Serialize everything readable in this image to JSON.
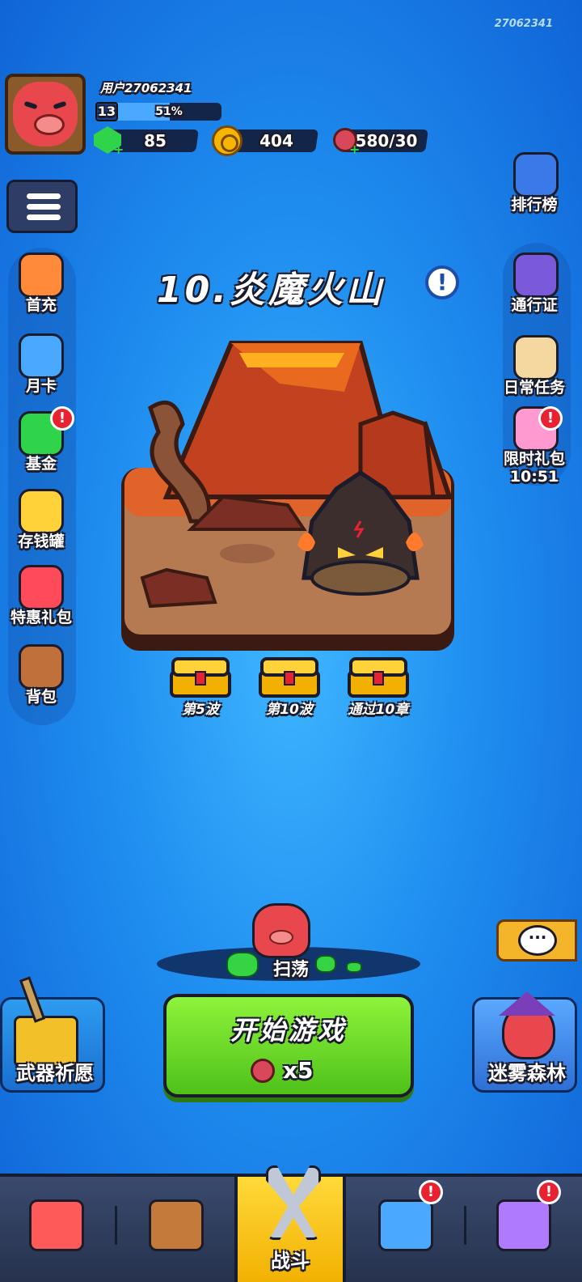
{
  "uid_watermark": "27062341",
  "player": {
    "username": "用户27062341",
    "level": "13",
    "xp_percent_label": "51%",
    "xp_fraction": 0.51,
    "gems": "85",
    "coins": "404",
    "stamina": "580/30"
  },
  "stage": {
    "title": "10.炎魔火山",
    "rewards": [
      {
        "label": "第5波"
      },
      {
        "label": "第10波"
      },
      {
        "label": "通过10章"
      }
    ]
  },
  "left_sidebar": [
    {
      "label": "首充",
      "icon": "first-recharge-icon",
      "badge": false
    },
    {
      "label": "月卡",
      "icon": "monthly-card-icon",
      "badge": false
    },
    {
      "label": "基金",
      "icon": "fund-icon",
      "badge": true
    },
    {
      "label": "存钱罐",
      "icon": "piggy-bank-icon",
      "badge": false
    },
    {
      "label": "特惠礼包",
      "icon": "gift-box-icon",
      "badge": false
    },
    {
      "label": "背包",
      "icon": "backpack-icon",
      "badge": false
    }
  ],
  "right_sidebar": [
    {
      "label": "排行榜",
      "icon": "leaderboard-icon",
      "badge": false
    },
    {
      "label": "通行证",
      "icon": "pass-icon",
      "badge": false
    },
    {
      "label": "日常任务",
      "icon": "daily-task-icon",
      "badge": false
    },
    {
      "label": "限时礼包",
      "icon": "limited-gift-icon",
      "badge": true,
      "timer": "10:51"
    }
  ],
  "badge_mark": "!",
  "sweep_label": "扫荡",
  "chat_icon_text": "···",
  "start_button": {
    "label": "开始游戏",
    "cost": "x5"
  },
  "features": {
    "left": "武器祈愿",
    "right": "迷雾森林"
  },
  "bottom_nav": [
    {
      "icon": "shop-icon",
      "label": "",
      "active": false,
      "badge": false
    },
    {
      "icon": "equipment-icon",
      "label": "",
      "active": false,
      "badge": false
    },
    {
      "icon": "battle-icon",
      "label": "战斗",
      "active": true,
      "badge": false
    },
    {
      "icon": "map-icon",
      "label": "",
      "active": false,
      "badge": true
    },
    {
      "icon": "hourglass-icon",
      "label": "",
      "active": false,
      "badge": true
    }
  ],
  "colors": {
    "background": "#1f8ef0",
    "start_button": "#6fdc2a",
    "badge_red": "#e82230",
    "nav_active": "#f7c414"
  }
}
